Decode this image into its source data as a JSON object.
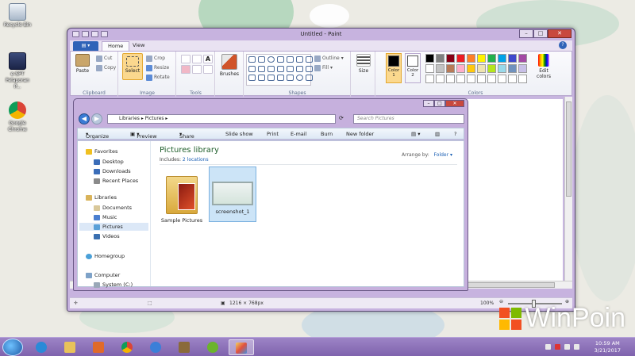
{
  "desktop": {
    "icons": [
      {
        "label": "Recycle Bin",
        "icon": "recycle-bin-icon"
      },
      {
        "label": "e-SPT Pelaporan P...",
        "icon": "application-icon"
      },
      {
        "label": "Google Chrome",
        "icon": "chrome-icon"
      }
    ],
    "watermark": "WinPoin"
  },
  "paint": {
    "title": "Untitled - Paint",
    "tabs": {
      "file": "",
      "home": "Home",
      "view": "View"
    },
    "clipboard": {
      "paste": "Paste",
      "cut": "Cut",
      "copy": "Copy",
      "group": "Clipboard"
    },
    "image": {
      "select": "Select",
      "crop": "Crop",
      "resize": "Resize",
      "rotate": "Rotate",
      "group": "Image"
    },
    "tools": {
      "group": "Tools"
    },
    "brushes": "Brushes",
    "shapes": {
      "outline": "Outline",
      "fill": "Fill",
      "group": "Shapes"
    },
    "size": "Size",
    "colors": {
      "color1": "Color 1",
      "color2": "Color 2",
      "edit": "Edit colors",
      "group": "Colors",
      "color1_value": "#000000",
      "color2_value": "#ffffff",
      "palette": [
        "#000000",
        "#7f7f7f",
        "#880015",
        "#ed1c24",
        "#ff7f27",
        "#fff200",
        "#22b14c",
        "#00a2e8",
        "#3f48cc",
        "#a349a4",
        "#ffffff",
        "#c3c3c3",
        "#b97a57",
        "#ffaec9",
        "#ffc90e",
        "#efe4b0",
        "#b5e61d",
        "#99d9ea",
        "#7092be",
        "#c8bfe7",
        "#ffffff",
        "#ffffff",
        "#ffffff",
        "#ffffff",
        "#ffffff",
        "#ffffff",
        "#ffffff",
        "#ffffff",
        "#ffffff",
        "#ffffff"
      ]
    }
  },
  "status": {
    "dimensions": "1216 × 768px",
    "zoom": "100%"
  },
  "explorer": {
    "address": [
      "Libraries",
      "Pictures"
    ],
    "search_placeholder": "Search Pictures",
    "toolbar": {
      "organize": "Organize",
      "preview": "Preview",
      "share": "Share with",
      "slideshow": "Slide show",
      "print": "Print",
      "email": "E-mail",
      "burn": "Burn",
      "newfolder": "New folder"
    },
    "nav": {
      "favorites": "Favorites",
      "desktop": "Desktop",
      "downloads": "Downloads",
      "recent": "Recent Places",
      "libraries": "Libraries",
      "documents": "Documents",
      "music": "Music",
      "pictures": "Pictures",
      "videos": "Videos",
      "homegroup": "Homegroup",
      "computer": "Computer",
      "system": "System (C:)"
    },
    "library_title": "Pictures library",
    "includes_label": "Includes:",
    "includes_link": "2 locations",
    "arrange_label": "Arrange by:",
    "arrange_value": "Folder",
    "files": [
      {
        "name": "Sample Pictures",
        "selected": false
      },
      {
        "name": "screenshot_1",
        "selected": true
      }
    ]
  },
  "taskbar": {
    "time": "10:59 AM",
    "date": "3/21/2017"
  }
}
